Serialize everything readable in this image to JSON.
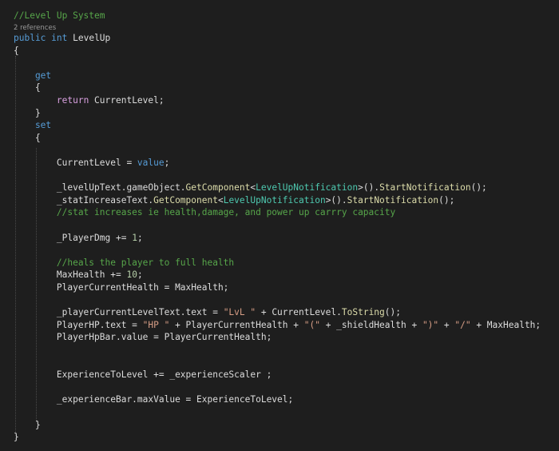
{
  "colors": {
    "background": "#1e1e1e",
    "plain": "#dcdcdc",
    "keyword": "#569cd6",
    "control": "#d8a0df",
    "comment": "#57a64a",
    "type": "#4ec9b0",
    "method": "#dcdcaa",
    "string": "#d69d85",
    "number": "#b5cea8",
    "codelens": "#999999"
  },
  "code": {
    "codelens": "2 references",
    "lines": [
      [
        {
          "t": "//Level Up System",
          "k": "comment"
        }
      ],
      [
        {
          "t": "public",
          "k": "keyword"
        },
        {
          "t": " ",
          "k": "plain"
        },
        {
          "t": "int",
          "k": "keyword"
        },
        {
          "t": " LevelUp",
          "k": "plain"
        }
      ],
      [
        {
          "t": "{",
          "k": "plain"
        }
      ],
      [],
      [
        {
          "t": "    get",
          "k": "keyword"
        }
      ],
      [
        {
          "t": "    {",
          "k": "plain"
        }
      ],
      [
        {
          "t": "        ",
          "k": "plain"
        },
        {
          "t": "return",
          "k": "control"
        },
        {
          "t": " CurrentLevel;",
          "k": "plain"
        }
      ],
      [
        {
          "t": "    }",
          "k": "plain"
        }
      ],
      [
        {
          "t": "    set",
          "k": "keyword"
        }
      ],
      [
        {
          "t": "    {",
          "k": "plain"
        }
      ],
      [],
      [
        {
          "t": "        CurrentLevel = ",
          "k": "plain"
        },
        {
          "t": "value",
          "k": "keyword"
        },
        {
          "t": ";",
          "k": "plain"
        }
      ],
      [],
      [
        {
          "t": "        _levelUpText.gameObject.",
          "k": "plain"
        },
        {
          "t": "GetComponent",
          "k": "method"
        },
        {
          "t": "<",
          "k": "plain"
        },
        {
          "t": "LevelUpNotification",
          "k": "type"
        },
        {
          "t": ">().",
          "k": "plain"
        },
        {
          "t": "StartNotification",
          "k": "method"
        },
        {
          "t": "();",
          "k": "plain"
        }
      ],
      [
        {
          "t": "        _statIncreaseText.",
          "k": "plain"
        },
        {
          "t": "GetComponent",
          "k": "method"
        },
        {
          "t": "<",
          "k": "plain"
        },
        {
          "t": "LevelUpNotification",
          "k": "type"
        },
        {
          "t": ">().",
          "k": "plain"
        },
        {
          "t": "StartNotification",
          "k": "method"
        },
        {
          "t": "();",
          "k": "plain"
        }
      ],
      [
        {
          "t": "        //stat increases ie health,damage, and power up carrry capacity",
          "k": "comment"
        }
      ],
      [],
      [
        {
          "t": "        _PlayerDmg += ",
          "k": "plain"
        },
        {
          "t": "1",
          "k": "number"
        },
        {
          "t": ";",
          "k": "plain"
        }
      ],
      [],
      [
        {
          "t": "        //heals the player to full health",
          "k": "comment"
        }
      ],
      [
        {
          "t": "        MaxHealth += ",
          "k": "plain"
        },
        {
          "t": "10",
          "k": "number"
        },
        {
          "t": ";",
          "k": "plain"
        }
      ],
      [
        {
          "t": "        PlayerCurrentHealth = MaxHealth;",
          "k": "plain"
        }
      ],
      [],
      [
        {
          "t": "        _playerCurrentLevelText.text = ",
          "k": "plain"
        },
        {
          "t": "\"LvL \"",
          "k": "string"
        },
        {
          "t": " + CurrentLevel.",
          "k": "plain"
        },
        {
          "t": "ToString",
          "k": "method"
        },
        {
          "t": "();",
          "k": "plain"
        }
      ],
      [
        {
          "t": "        PlayerHP.text = ",
          "k": "plain"
        },
        {
          "t": "\"HP \"",
          "k": "string"
        },
        {
          "t": " + PlayerCurrentHealth + ",
          "k": "plain"
        },
        {
          "t": "\"(\"",
          "k": "string"
        },
        {
          "t": " + _shieldHealth + ",
          "k": "plain"
        },
        {
          "t": "\")\"",
          "k": "string"
        },
        {
          "t": " + ",
          "k": "plain"
        },
        {
          "t": "\"/\"",
          "k": "string"
        },
        {
          "t": " + MaxHealth;",
          "k": "plain"
        }
      ],
      [
        {
          "t": "        PlayerHpBar.value = PlayerCurrentHealth;",
          "k": "plain"
        }
      ],
      [],
      [],
      [
        {
          "t": "        ExperienceToLevel += _experienceScaler ;",
          "k": "plain"
        }
      ],
      [],
      [
        {
          "t": "        _experienceBar.maxValue = ExperienceToLevel;",
          "k": "plain"
        }
      ],
      [],
      [
        {
          "t": "    }",
          "k": "plain"
        }
      ],
      [
        {
          "t": "}",
          "k": "plain"
        }
      ]
    ]
  }
}
